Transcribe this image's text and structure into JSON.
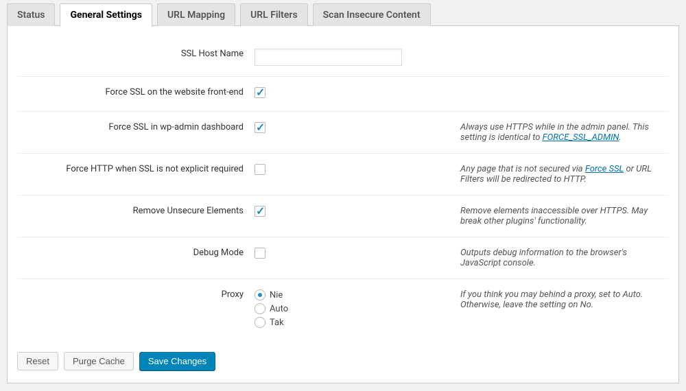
{
  "tabs": [
    {
      "label": "Status"
    },
    {
      "label": "General Settings"
    },
    {
      "label": "URL Mapping"
    },
    {
      "label": "URL Filters"
    },
    {
      "label": "Scan Insecure Content"
    }
  ],
  "fields": {
    "ssl_host": {
      "label": "SSL Host Name",
      "value": ""
    },
    "force_front": {
      "label": "Force SSL on the website front-end",
      "checked": true
    },
    "force_admin": {
      "label": "Force SSL in wp-admin dashboard",
      "checked": true,
      "help_pre": "Always use HTTPS while in the admin panel. This setting is identical to ",
      "help_link": "FORCE_SSL_ADMIN",
      "help_post": "."
    },
    "force_http": {
      "label": "Force HTTP when SSL is not explicit required",
      "checked": false,
      "help_pre": "Any page that is not secured via ",
      "help_link": "Force SSL",
      "help_post": " or URL Filters will be redirected to HTTP."
    },
    "remove_unsecure": {
      "label": "Remove Unsecure Elements",
      "checked": true,
      "help": "Remove elements inaccessible over HTTPS. May break other plugins' functionality."
    },
    "debug": {
      "label": "Debug Mode",
      "checked": false,
      "help": "Outputs debug information to the browser's JavaScript console."
    },
    "proxy": {
      "label": "Proxy",
      "options": [
        "Nie",
        "Auto",
        "Tak"
      ],
      "selected": "Nie",
      "help": "If you think you may behind a proxy, set to Auto. Otherwise, leave the setting on No."
    }
  },
  "buttons": {
    "reset": "Reset",
    "purge": "Purge Cache",
    "save": "Save Changes"
  }
}
